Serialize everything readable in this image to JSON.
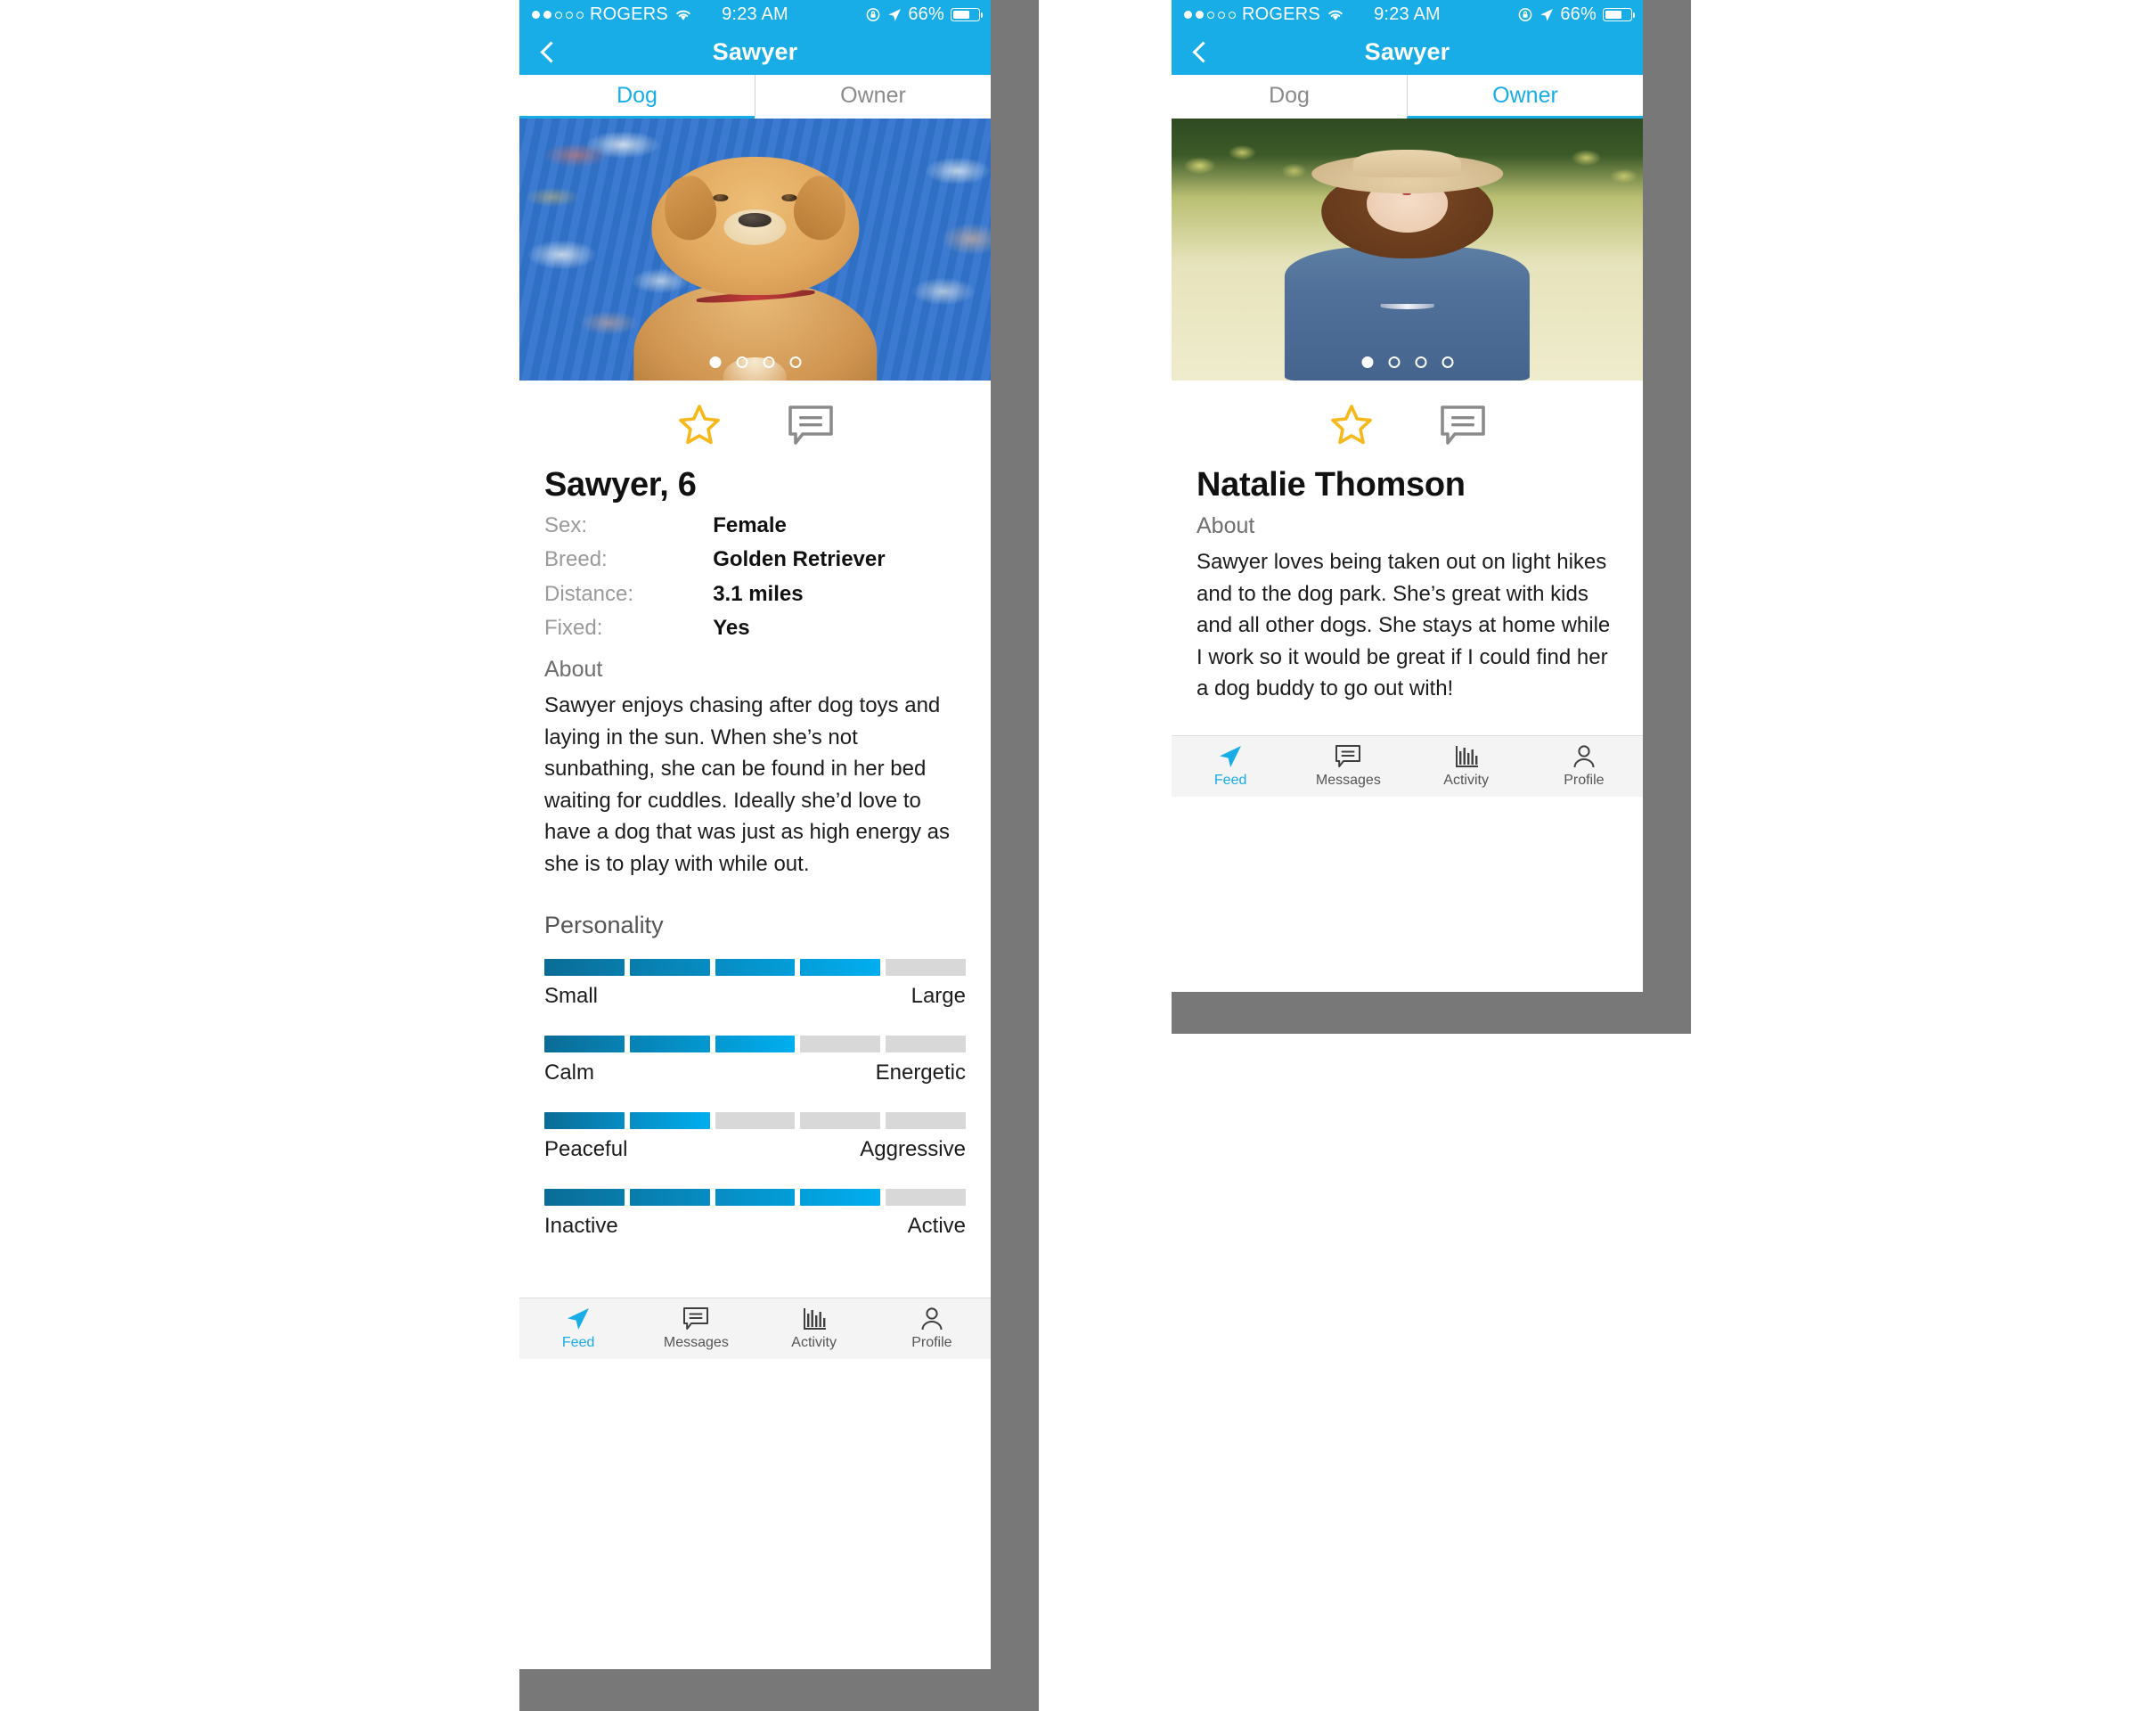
{
  "status_bar": {
    "carrier": "ROGERS",
    "time": "9:23 AM",
    "battery_percent": "66%",
    "signal_dots_filled": 2,
    "signal_dots_total": 5,
    "icons": [
      "wifi-icon",
      "rotation-lock-icon",
      "location-arrow-icon",
      "battery-icon"
    ]
  },
  "nav": {
    "title": "Sawyer",
    "back_icon": "chevron-left-icon"
  },
  "tabs": {
    "dog": "Dog",
    "owner": "Owner"
  },
  "colors": {
    "accent": "#18ADE7",
    "star": "#F7B81B",
    "bar_empty": "#D8D8D8",
    "bar_start": "#0B6C96",
    "bar_end": "#00AEEF",
    "muted_text": "#9A9A9A",
    "frame": "#787878"
  },
  "carousel": {
    "total": 4,
    "active_index": 0
  },
  "actions": {
    "favorite_icon": "star-icon",
    "message_icon": "chat-bubble-icon"
  },
  "dog_screen": {
    "active_tab": "Dog",
    "name": "Sawyer, 6",
    "details": [
      {
        "label": "Sex:",
        "value": "Female"
      },
      {
        "label": "Breed:",
        "value": "Golden Retriever"
      },
      {
        "label": "Distance:",
        "value": "3.1 miles"
      },
      {
        "label": "Fixed:",
        "value": "Yes"
      }
    ],
    "about_heading": "About",
    "about_text": "Sawyer enjoys chasing after dog toys and laying in the sun. When she’s not sunbathing, she can be found in her bed waiting for cuddles. Ideally she’d love to have a dog that was just as high energy as she is to play with while out.",
    "personality_heading": "Personality",
    "personality": [
      {
        "left": "Small",
        "right": "Large",
        "filled": 4,
        "total": 5
      },
      {
        "left": "Calm",
        "right": "Energetic",
        "filled": 3,
        "total": 5
      },
      {
        "left": "Peaceful",
        "right": "Aggressive",
        "filled": 2,
        "total": 5
      },
      {
        "left": "Inactive",
        "right": "Active",
        "filled": 4,
        "total": 5
      }
    ],
    "photo_alt": "golden-retriever-puppy-on-blue-blanket"
  },
  "owner_screen": {
    "active_tab": "Owner",
    "name": "Natalie Thomson",
    "about_heading": "About",
    "about_text": "Sawyer loves being taken out on light hikes and to the dog park. She’s great with kids and all other dogs. She stays at home while I work so it would be great if I could find her a dog buddy to go out with!",
    "photo_alt": "woman-in-hat-and-denim-dress-in-field"
  },
  "tabbar": [
    {
      "label": "Feed",
      "icon": "paper-plane-icon",
      "active": true
    },
    {
      "label": "Messages",
      "icon": "chat-bubble-icon",
      "active": false
    },
    {
      "label": "Activity",
      "icon": "bar-chart-icon",
      "active": false
    },
    {
      "label": "Profile",
      "icon": "person-icon",
      "active": false
    }
  ]
}
